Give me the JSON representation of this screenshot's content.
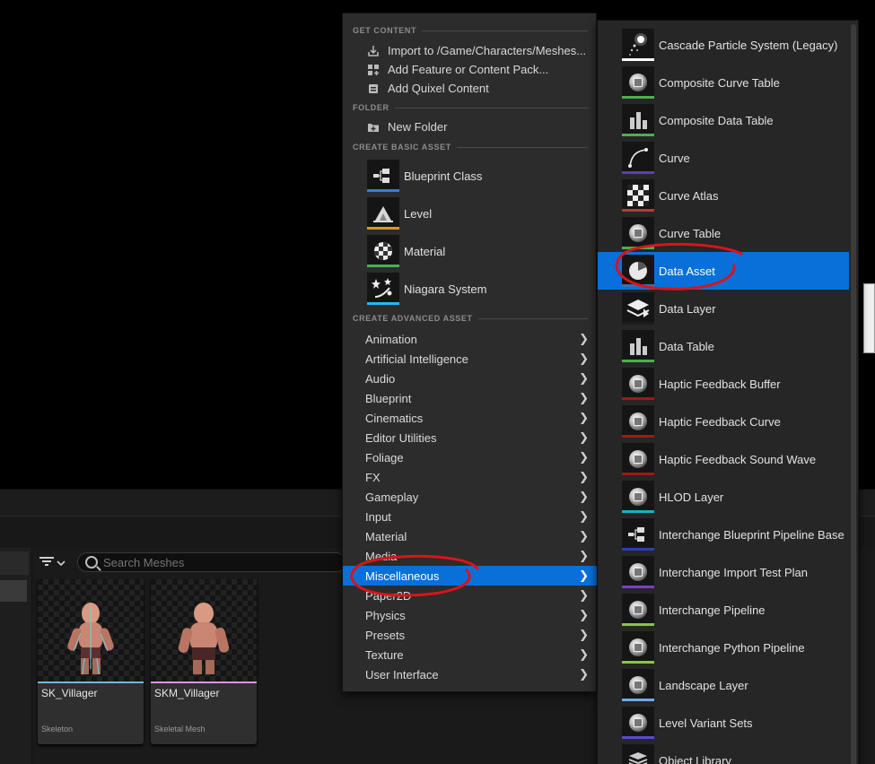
{
  "menu": {
    "sections": {
      "get_content": "GET CONTENT",
      "folder": "FOLDER",
      "create_basic": "CREATE BASIC ASSET",
      "create_advanced": "CREATE ADVANCED ASSET"
    },
    "get_content_items": [
      {
        "label": "Import to /Game/Characters/Meshes...",
        "icon": "import-icon"
      },
      {
        "label": "Add Feature or Content Pack...",
        "icon": "feature-pack-icon"
      },
      {
        "label": "Add Quixel Content",
        "icon": "quixel-icon"
      }
    ],
    "folder_items": [
      {
        "label": "New Folder",
        "icon": "new-folder-icon"
      }
    ],
    "basic_assets": [
      {
        "label": "Blueprint Class",
        "icon": "blueprint-class-icon",
        "color": "#3a7bd5"
      },
      {
        "label": "Level",
        "icon": "level-icon",
        "color": "#e0961e"
      },
      {
        "label": "Material",
        "icon": "material-icon",
        "color": "#4caf50"
      },
      {
        "label": "Niagara System",
        "icon": "niagara-icon",
        "color": "#29b6f6"
      }
    ],
    "advanced_categories": [
      "Animation",
      "Artificial Intelligence",
      "Audio",
      "Blueprint",
      "Cinematics",
      "Editor Utilities",
      "Foliage",
      "FX",
      "Gameplay",
      "Input",
      "Material",
      "Media",
      "Miscellaneous",
      "Paper2D",
      "Physics",
      "Presets",
      "Texture",
      "User Interface"
    ],
    "active_category": "Miscellaneous"
  },
  "submenu": {
    "items": [
      {
        "label": "Cascade Particle System (Legacy)",
        "icon": "cascade-icon",
        "color": "#ffffff"
      },
      {
        "label": "Composite Curve Table",
        "icon": "curve-table-icon",
        "color": "#4caf50"
      },
      {
        "label": "Composite Data Table",
        "icon": "data-table-icon",
        "color": "#4caf50"
      },
      {
        "label": "Curve",
        "icon": "curve-icon",
        "color": "#5c3fb8"
      },
      {
        "label": "Curve Atlas",
        "icon": "curve-atlas-icon",
        "color": "#b23a3a"
      },
      {
        "label": "Curve Table",
        "icon": "curve-table-icon",
        "color": "#4caf50"
      },
      {
        "label": "Data Asset",
        "icon": "data-asset-icon",
        "color": "#3c6fb5"
      },
      {
        "label": "Data Layer",
        "icon": "data-layer-icon",
        "color": "#1c1c1c"
      },
      {
        "label": "Data Table",
        "icon": "data-table-icon",
        "color": "#4caf50"
      },
      {
        "label": "Haptic Feedback Buffer",
        "icon": "haptic-icon",
        "color": "#a01818"
      },
      {
        "label": "Haptic Feedback Curve",
        "icon": "haptic-icon",
        "color": "#a01818"
      },
      {
        "label": "Haptic Feedback Sound Wave",
        "icon": "haptic-icon",
        "color": "#a01818"
      },
      {
        "label": "HLOD Layer",
        "icon": "hlod-icon",
        "color": "#19b0c4"
      },
      {
        "label": "Interchange Blueprint Pipeline Base",
        "icon": "interchange-blueprint-icon",
        "color": "#2a3fb0"
      },
      {
        "label": "Interchange Import Test Plan",
        "icon": "interchange-icon",
        "color": "#7a3fc2"
      },
      {
        "label": "Interchange Pipeline",
        "icon": "interchange-icon",
        "color": "#8bc34a"
      },
      {
        "label": "Interchange Python Pipeline",
        "icon": "interchange-icon",
        "color": "#8bc34a"
      },
      {
        "label": "Landscape Layer",
        "icon": "landscape-icon",
        "color": "#6fa9e8"
      },
      {
        "label": "Level Variant Sets",
        "icon": "variant-icon",
        "color": "#5a4bd0"
      },
      {
        "label": "Object Library",
        "icon": "object-library-icon",
        "color": "#555555"
      }
    ],
    "active_item": "Data Asset"
  },
  "browser": {
    "search_placeholder": "Search Meshes",
    "assets": [
      {
        "name": "SK_Villager",
        "type": "Skeleton",
        "color": "#6bb8e0"
      },
      {
        "name": "SKM_Villager",
        "type": "Skeletal Mesh",
        "color": "#e090e8"
      }
    ]
  },
  "colors": {
    "highlight": "#0870d8",
    "annotation": "#d8141c"
  }
}
